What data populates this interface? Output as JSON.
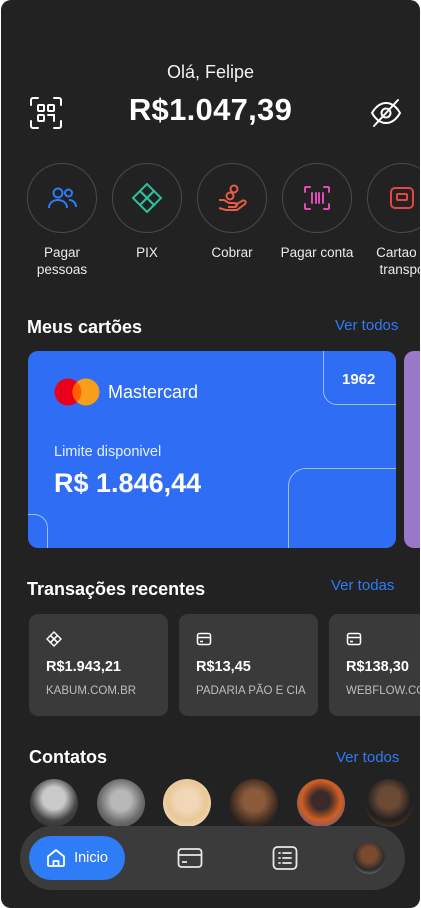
{
  "header": {
    "greeting": "Olá, Felipe",
    "balance": "R$1.047,39",
    "scan_icon": "qr-scan-icon",
    "hide_icon": "eye-off-icon"
  },
  "actions": [
    {
      "label": "Pagar pessoas",
      "icon": "people-icon"
    },
    {
      "label": "PIX",
      "icon": "pix-icon"
    },
    {
      "label": "Cobrar",
      "icon": "hand-coins-icon"
    },
    {
      "label": "Pagar conta",
      "icon": "barcode-icon"
    },
    {
      "label": "Cartao e transpo",
      "icon": "transport-card-icon"
    }
  ],
  "cards_section": {
    "title": "Meus cartões",
    "link": "Ver todos",
    "card": {
      "brand": "Mastercard",
      "number": "1962",
      "limit_label": "Limite disponivel",
      "limit_value": "R$ 1.846,44",
      "color": "#2F6DF5"
    },
    "next_card_color": "#9A78C8"
  },
  "transactions_section": {
    "title": "Transações recentes",
    "link": "Ver todas",
    "items": [
      {
        "amount": "R$1.943,21",
        "merchant": "KABUM.COM.BR",
        "icon": "pix-icon"
      },
      {
        "amount": "R$13,45",
        "merchant": "PADARIA PÃO E CIA",
        "icon": "card-icon"
      },
      {
        "amount": "R$138,30",
        "merchant": "WEBFLOW.CO",
        "icon": "card-icon"
      }
    ]
  },
  "contacts_section": {
    "title": "Contatos",
    "link": "Ver todos",
    "count": 6
  },
  "bottom_nav": {
    "home_label": "Inicio",
    "items": [
      "home-icon",
      "card-icon",
      "list-icon",
      "profile-avatar"
    ]
  },
  "colors": {
    "accent": "#2E7CF6",
    "background": "#222222",
    "surface": "#3A3A3A",
    "icon_action": "#E04646"
  }
}
